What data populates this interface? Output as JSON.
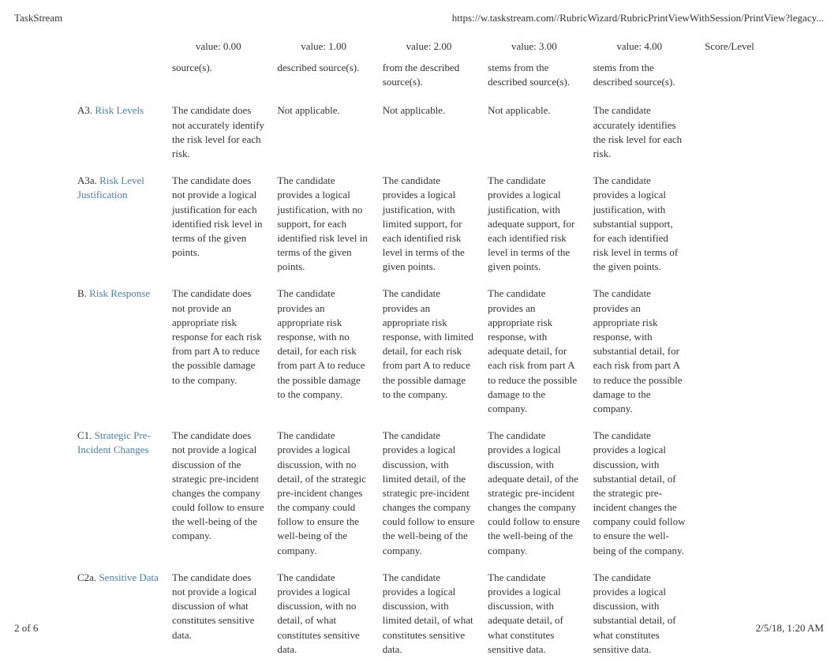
{
  "header": {
    "title": "TaskStream",
    "url": "https://w.taskstream.com//RubricWizard/RubricPrintViewWithSession/PrintView?legacy..."
  },
  "table": {
    "headers": [
      "",
      "value: 0.00",
      "value: 1.00",
      "value: 2.00",
      "value: 3.00",
      "value: 4.00",
      "Score/Level"
    ],
    "partial_row": {
      "cells": [
        "",
        "source(s).",
        "described source(s).",
        "from the described source(s).",
        "stems from the described source(s).",
        "stems from the described source(s).",
        ""
      ]
    },
    "rows": [
      {
        "prefix": "A3. ",
        "link": "Risk Levels",
        "cells": [
          "The candidate does not accurately identify the risk level for  each risk.",
          "Not applicable.",
          "Not applicable.",
          "Not applicable.",
          "The candidate accurately identifies the risk level for each risk.",
          ""
        ]
      },
      {
        "prefix": "A3a. ",
        "link": "Risk Level Justification",
        "cells": [
          "The candidate does not provide a logical justification for  each identified risk level in terms of the given points.",
          "The candidate provides a logical justification, with no support, for  each identified risk level in terms of the given points.",
          "The candidate provides a logical justification, with limited support, for each  identified risk level in terms of the given points.",
          "The candidate provides a logical justification, with adequate support, for each  identified risk level in terms of the given points.",
          "The candidate provides a logical justification, with substantial support, for each  identified risk level in terms of the given points.",
          ""
        ]
      },
      {
        "prefix": "B. ",
        "link": "Risk Response",
        "cells": [
          "The candidate does not provide an appropriate risk response for  each risk from part A to reduce the possible damage to the company.",
          "The candidate provides an appropriate risk response, with no detail, for  each risk from part A to reduce the possible damage to the company.",
          "The candidate provides an appropriate risk response, with limited detail, for each  risk from part A to reduce the possible damage to the company.",
          "The candidate provides an appropriate risk response, with adequate detail, for each risk from part A to reduce the possible damage to the company.",
          "The candidate provides an appropriate risk response, with substantial detail, for each  risk from part A to reduce the possible damage to the company.",
          ""
        ]
      },
      {
        "prefix": "C1. ",
        "link": "Strategic Pre-Incident Changes",
        "cells": [
          "The candidate does not provide a logical discussion of the strategic pre-incident changes the company could follow to ensure the well-being of the company.",
          "The candidate provides a logical discussion, with no detail, of the strategic pre-incident changes the company could follow to ensure the well-being of the company.",
          "The candidate provides a logical discussion, with limited detail, of the strategic pre-incident changes the company could follow to ensure the well-being of the company.",
          "The candidate provides a logical discussion, with adequate detail, of the strategic pre-incident changes the company could follow to ensure the well-being of the company.",
          "The candidate provides a logical discussion, with substantial detail, of the strategic pre-incident changes the company could follow to ensure the well-being of the company.",
          ""
        ]
      },
      {
        "prefix": "C2a. ",
        "link": "Sensitive Data",
        "cells": [
          "The candidate does not provide a logical discussion of what constitutes sensitive data.",
          "The candidate provides a logical discussion, with no detail, of what constitutes sensitive data.",
          "The candidate provides a logical discussion, with limited detail, of what constitutes sensitive data.",
          "The candidate provides a logical discussion, with adequate detail, of what constitutes sensitive data.",
          "The candidate provides a logical discussion, with substantial detail, of what constitutes sensitive data.",
          ""
        ]
      }
    ]
  },
  "footer": {
    "page": "2 of 6",
    "datetime": "2/5/18, 1:20 AM"
  }
}
